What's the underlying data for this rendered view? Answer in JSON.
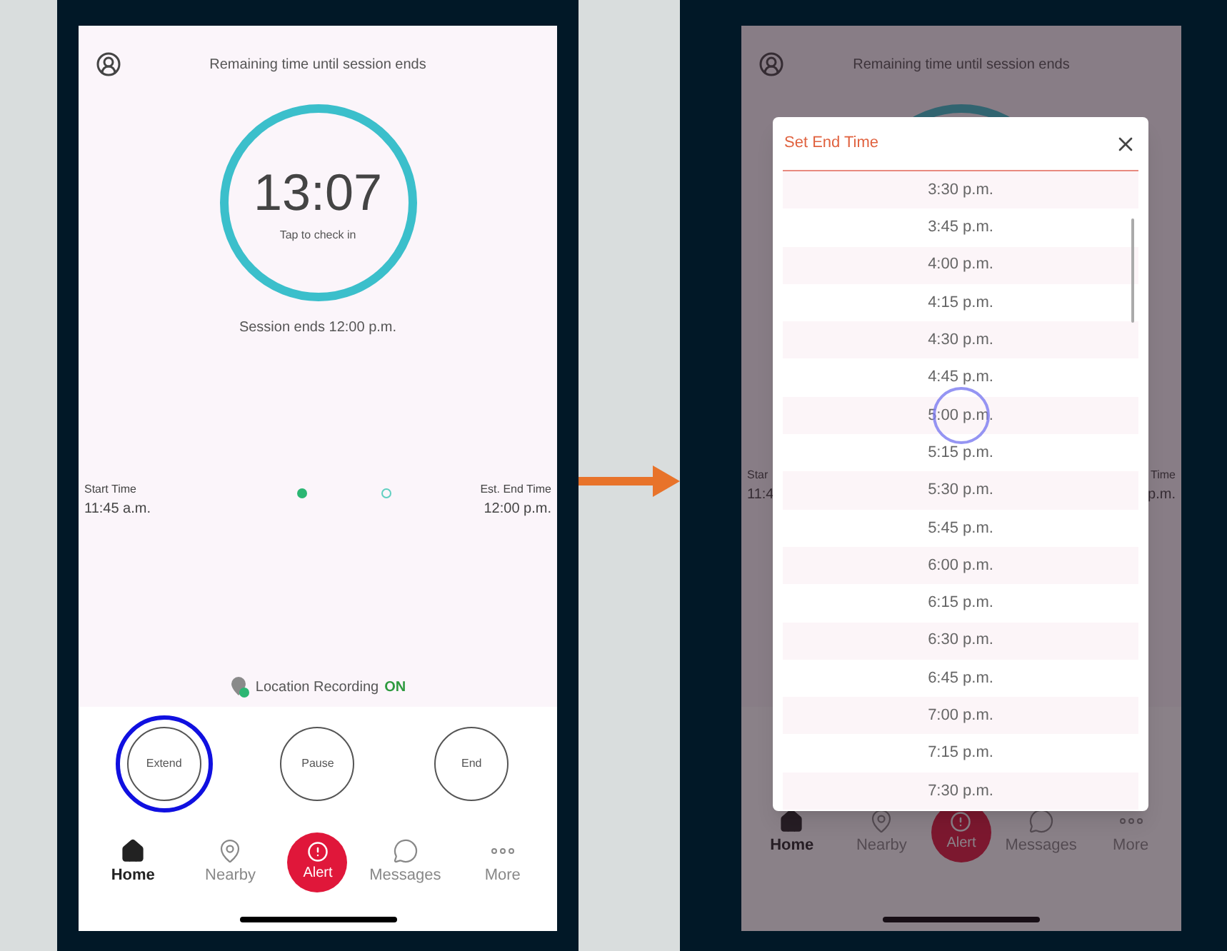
{
  "home_screen": {
    "header": "Remaining time until session ends",
    "timer": {
      "time": "13:07",
      "hint": "Tap to check in",
      "level": 1
    },
    "session_end": "Session ends 12:00 p.m.",
    "start": {
      "label": "Start Time",
      "value": "11:45 a.m."
    },
    "end": {
      "label": "Est. End Time",
      "value": "12:00 p.m."
    },
    "dots": [
      {
        "filled": true
      },
      {
        "filled": false
      }
    ],
    "location": {
      "label": "Location Recording",
      "status": "ON",
      "on": true
    },
    "actions": [
      {
        "label": "Extend",
        "highlighted": true
      },
      {
        "label": "Pause",
        "highlighted": false
      },
      {
        "label": "End",
        "highlighted": false
      }
    ],
    "nav": [
      {
        "label": "Home",
        "kind": "home",
        "selected": true
      },
      {
        "label": "Nearby",
        "kind": "nearby",
        "selected": false
      },
      {
        "label": "Alert",
        "kind": "alert",
        "selected": false
      },
      {
        "label": "Messages",
        "kind": "messages",
        "selected": false
      },
      {
        "label": "More",
        "kind": "more",
        "selected": false
      }
    ]
  },
  "dialog_screen": {
    "header": "Remaining time until session ends",
    "start_fragments": [
      "Star",
      "11:4"
    ],
    "end_fragments": [
      "Time",
      "p.m."
    ],
    "nav": [
      {
        "label": "Home",
        "kind": "home",
        "selected": true
      },
      {
        "label": "Nearby",
        "kind": "nearby",
        "selected": false
      },
      {
        "label": "Alert",
        "kind": "alert",
        "selected": false
      },
      {
        "label": "Messages",
        "kind": "messages",
        "selected": false
      },
      {
        "label": "More",
        "kind": "more",
        "selected": false
      }
    ],
    "dialog": {
      "title": "Set End Time",
      "times": [
        {
          "label": "3:30 p.m.",
          "tapped": false
        },
        {
          "label": "3:45 p.m.",
          "tapped": false
        },
        {
          "label": "4:00 p.m.",
          "tapped": false
        },
        {
          "label": "4:15 p.m.",
          "tapped": false
        },
        {
          "label": "4:30 p.m.",
          "tapped": false
        },
        {
          "label": "4:45 p.m.",
          "tapped": false
        },
        {
          "label": "5:00 p.m.",
          "tapped": true
        },
        {
          "label": "5:15 p.m.",
          "tapped": false
        },
        {
          "label": "5:30 p.m.",
          "tapped": false
        },
        {
          "label": "5:45 p.m.",
          "tapped": false
        },
        {
          "label": "6:00 p.m.",
          "tapped": false
        },
        {
          "label": "6:15 p.m.",
          "tapped": false
        },
        {
          "label": "6:30 p.m.",
          "tapped": false
        },
        {
          "label": "6:45 p.m.",
          "tapped": false
        },
        {
          "label": "7:00 p.m.",
          "tapped": false
        },
        {
          "label": "7:15 p.m.",
          "tapped": false
        },
        {
          "label": "7:30 p.m.",
          "tapped": false
        }
      ]
    }
  }
}
